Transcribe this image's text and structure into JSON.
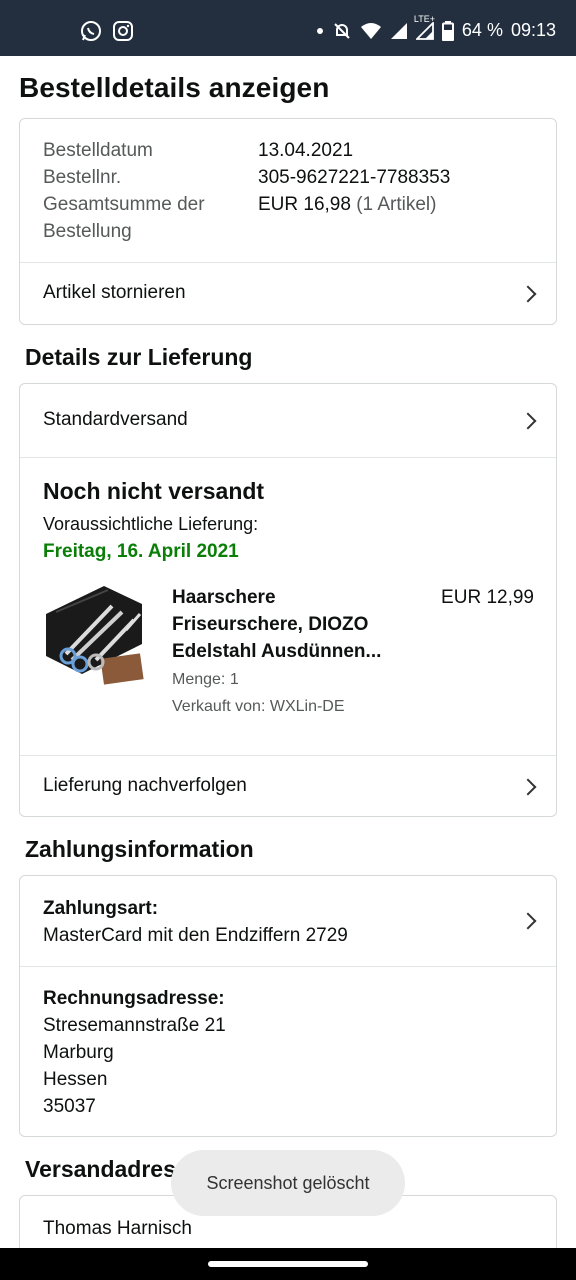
{
  "status_bar": {
    "battery": "64 %",
    "time": "09:13",
    "network": "LTE+"
  },
  "page": {
    "title": "Bestelldetails anzeigen"
  },
  "order_summary": {
    "date_label": "Bestelldatum",
    "date_value": "13.04.2021",
    "number_label": "Bestellnr.",
    "number_value": "305-9627221-7788353",
    "total_label_line1": "Gesamtsumme der",
    "total_label_line2": "Bestellung",
    "total_value": "EUR 16,98",
    "total_items": "(1 Artikel)",
    "cancel_label": "Artikel stornieren"
  },
  "delivery": {
    "section_title": "Details zur Lieferung",
    "shipping_method": "Standardversand",
    "status": "Noch nicht versandt",
    "expected_label": "Voraussichtliche Lieferung:",
    "expected_date": "Freitag, 16. April 2021",
    "item": {
      "title_line1": "Haarschere",
      "title_line2": "Friseurschere, DIOZO",
      "title_line3": "Edelstahl Ausdünnen...",
      "price": "EUR 12,99",
      "quantity": "Menge: 1",
      "seller": "Verkauft von: WXLin-DE",
      "image_icon": "scissors-set-icon"
    },
    "track_label": "Lieferung nachverfolgen"
  },
  "payment": {
    "section_title": "Zahlungsinformation",
    "method_label": "Zahlungsart:",
    "method_value": "MasterCard mit den Endziffern 2729",
    "billing_label": "Rechnungsadresse:",
    "billing_lines": [
      "Stresemannstraße 21",
      "Marburg",
      "Hessen",
      "35037"
    ]
  },
  "shipping_address": {
    "section_title": "Versandadresse",
    "name": "Thomas Harnisch"
  },
  "toast": {
    "text": "Screenshot gelöscht"
  },
  "colors": {
    "status_bar_bg": "#232f3e",
    "delivery_green": "#0a7e07",
    "border": "#d5d9d9"
  }
}
